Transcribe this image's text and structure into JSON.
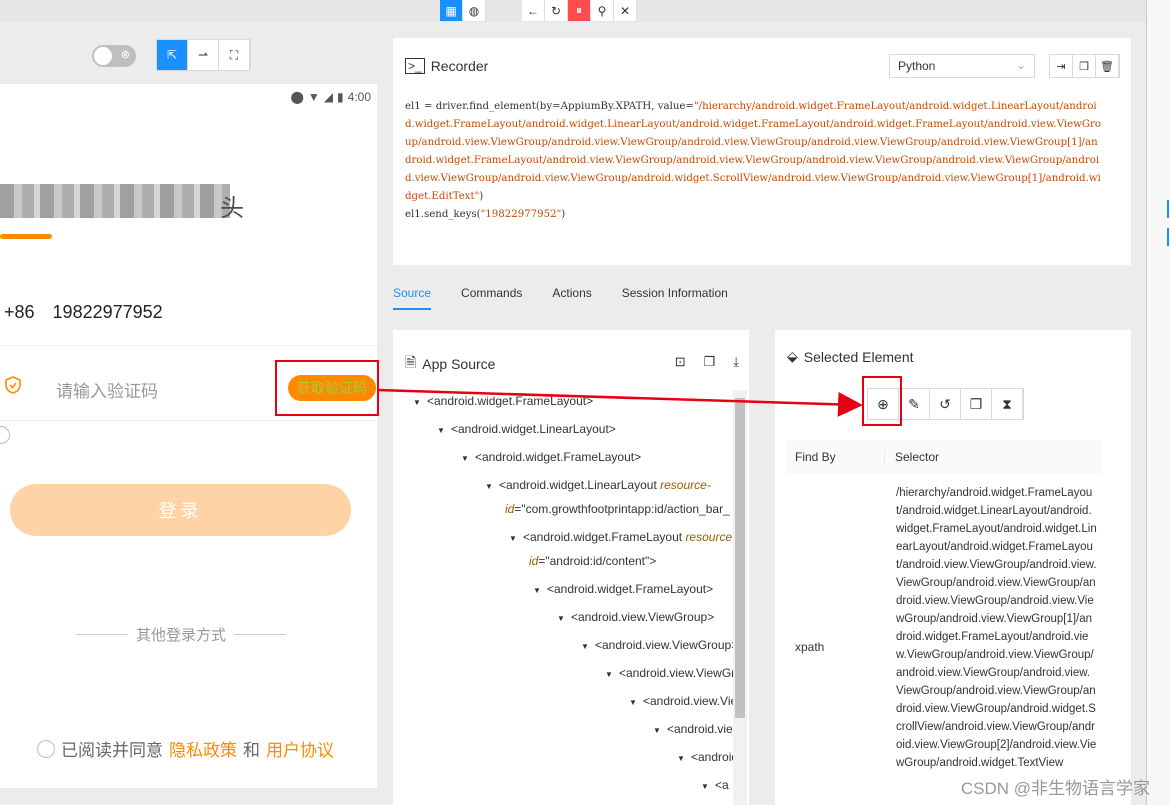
{
  "toolbar": {
    "buttons": [
      "grid-icon",
      "globe-icon",
      "back-icon",
      "refresh-icon",
      "pause-icon",
      "search-icon",
      "close-icon"
    ]
  },
  "device": {
    "status_time": "4:00",
    "phone_prefix": "+86",
    "phone_number": "19822977952",
    "code_placeholder": "请输入验证码",
    "get_code": "获取验证码",
    "login": "登录",
    "other_login": "其他登录方式",
    "agree_prefix": "已阅读并同意",
    "privacy": "隐私政策",
    "and": "和",
    "user_agreement": "用户协议",
    "title_tail": "头"
  },
  "recorder": {
    "title": "Recorder",
    "language": "Python",
    "code_prefix": "el1 = driver.find_element(by=AppiumBy.XPATH, value=",
    "xpath": "\"/hierarchy/android.widget.FrameLayout/android.widget.LinearLayout/android.widget.FrameLayout/android.widget.LinearLayout/android.widget.FrameLayout/android.widget.FrameLayout/android.view.ViewGroup/android.view.ViewGroup/android.view.ViewGroup/android.view.ViewGroup/android.view.ViewGroup/android.view.ViewGroup[1]/android.widget.FrameLayout/android.view.ViewGroup/android.view.ViewGroup/android.view.ViewGroup/android.view.ViewGroup/android.view.ViewGroup/android.view.ViewGroup/android.widget.ScrollView/android.view.ViewGroup/android.view.ViewGroup[1]/android.widget.EditText\"",
    "code_suffix": ")",
    "line2_prefix": "el1.send_keys(",
    "line2_str": "\"19822977952\"",
    "line2_suffix": ")"
  },
  "tabs": [
    "Source",
    "Commands",
    "Actions",
    "Session Information"
  ],
  "app_source": {
    "title": "App Source",
    "nodes": [
      {
        "text": "<android.widget.FrameLayout>"
      },
      {
        "text": "<android.widget.LinearLayout>"
      },
      {
        "text": "<android.widget.FrameLayout>"
      },
      {
        "text": "<android.widget.LinearLayout",
        "attr": "resource-",
        "cont_attr": "id",
        "cont_val": "=\"com.growthfootprintapp:id/action_bar_"
      },
      {
        "text": "<android.widget.FrameLayout",
        "attr": "resource",
        "cont_attr": "id",
        "cont_val": "=\"android:id/content\">"
      },
      {
        "text": "<android.widget.FrameLayout>"
      },
      {
        "text": "<android.view.ViewGroup>"
      },
      {
        "text": "<android.view.ViewGroup>"
      },
      {
        "text": "<android.view.ViewGroup>"
      },
      {
        "text": "<android.view.ViewGroup>"
      },
      {
        "text": "<android.view.ViewGroup>"
      },
      {
        "text": "<android.view.ViewGroup>"
      },
      {
        "text": "<a"
      }
    ]
  },
  "selected_element": {
    "title": "Selected Element",
    "find_by_header": "Find By",
    "selector_header": "Selector",
    "find_by": "xpath",
    "selector": "/hierarchy/android.widget.FrameLayout/android.widget.LinearLayout/android.widget.FrameLayout/android.widget.LinearLayout/android.widget.FrameLayout/android.view.ViewGroup/android.view.ViewGroup/android.view.ViewGroup/android.view.ViewGroup/android.view.ViewGroup/android.view.ViewGroup[1]/android.widget.FrameLayout/android.view.ViewGroup/android.view.ViewGroup/android.view.ViewGroup/android.view.ViewGroup/android.view.ViewGroup/android.view.ViewGroup/android.widget.ScrollView/android.view.ViewGroup/android.view.ViewGroup[2]/android.view.ViewGroup/android.widget.TextView"
  },
  "watermark": "CSDN @非生物语言学家",
  "colors": {
    "accent": "#1890ff",
    "orange": "#ff8a00",
    "highlight": "#e60012"
  }
}
